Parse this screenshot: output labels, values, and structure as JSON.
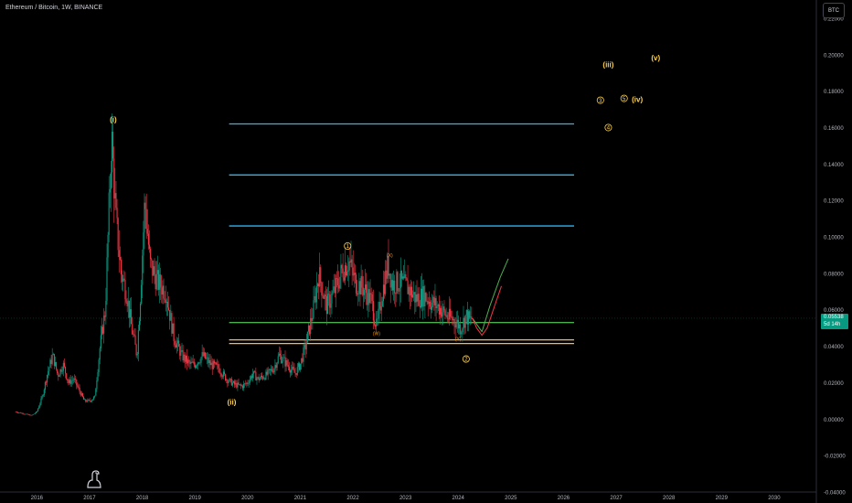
{
  "header": {
    "title": "Ethereum / Bitcoin, 1W, BINANCE",
    "currency_button": "BTC"
  },
  "price_tag": {
    "price": "0.05538",
    "countdown": "5d 14h",
    "color": "#089981"
  },
  "colors": {
    "background": "#000000",
    "candle_up": "#089981",
    "candle_down": "#f23645",
    "fib_lines": "#29b6f6",
    "support_green": "#4caf50",
    "support_orange": "#ffb74d",
    "wave_labels": "#ffd54f",
    "projection": "#4caf50",
    "projection_alt": "#f23645"
  },
  "chart_data": {
    "type": "candlestick",
    "interval": "1W",
    "symbol": "ETHBTC",
    "exchange": "BINANCE",
    "x_axis": {
      "range": [
        2015.3,
        2030.8
      ],
      "tick_labels": [
        "2016",
        "2017",
        "2018",
        "2019",
        "2020",
        "2021",
        "2022",
        "2023",
        "2024",
        "2025",
        "2026",
        "2027",
        "2028",
        "2029",
        "2030"
      ],
      "tick_values": [
        2016,
        2017,
        2018,
        2019,
        2020,
        2021,
        2022,
        2023,
        2024,
        2025,
        2026,
        2027,
        2028,
        2029,
        2030
      ]
    },
    "y_axis": {
      "range": [
        -0.04,
        0.23
      ],
      "position": "right",
      "tick_labels": [
        "0.22000",
        "0.20000",
        "0.18000",
        "0.16000",
        "0.14000",
        "0.12000",
        "0.10000",
        "0.08000",
        "0.06000",
        "0.04000",
        "0.02000",
        "0.00000",
        "-0.02000",
        "-0.04000"
      ],
      "tick_values": [
        0.22,
        0.2,
        0.18,
        0.16,
        0.14,
        0.12,
        0.1,
        0.08,
        0.06,
        0.04,
        0.02,
        0.0,
        -0.02,
        -0.04
      ]
    },
    "price_path": [
      [
        2015.6,
        0.004
      ],
      [
        2015.75,
        0.003
      ],
      [
        2015.9,
        0.002
      ],
      [
        2016.0,
        0.004
      ],
      [
        2016.1,
        0.012
      ],
      [
        2016.2,
        0.025
      ],
      [
        2016.3,
        0.035
      ],
      [
        2016.4,
        0.024
      ],
      [
        2016.5,
        0.03
      ],
      [
        2016.6,
        0.02
      ],
      [
        2016.7,
        0.022
      ],
      [
        2016.8,
        0.016
      ],
      [
        2016.9,
        0.01
      ],
      [
        2017.0,
        0.01
      ],
      [
        2017.1,
        0.012
      ],
      [
        2017.2,
        0.04
      ],
      [
        2017.3,
        0.06
      ],
      [
        2017.42,
        0.155
      ],
      [
        2017.5,
        0.11
      ],
      [
        2017.6,
        0.08
      ],
      [
        2017.7,
        0.07
      ],
      [
        2017.8,
        0.05
      ],
      [
        2017.9,
        0.035
      ],
      [
        2017.97,
        0.07
      ],
      [
        2018.05,
        0.12
      ],
      [
        2018.15,
        0.085
      ],
      [
        2018.3,
        0.075
      ],
      [
        2018.45,
        0.07
      ],
      [
        2018.6,
        0.045
      ],
      [
        2018.75,
        0.035
      ],
      [
        2018.9,
        0.03
      ],
      [
        2019.0,
        0.03
      ],
      [
        2019.15,
        0.035
      ],
      [
        2019.3,
        0.03
      ],
      [
        2019.45,
        0.028
      ],
      [
        2019.6,
        0.022
      ],
      [
        2019.75,
        0.019
      ],
      [
        2019.9,
        0.018
      ],
      [
        2020.0,
        0.02
      ],
      [
        2020.1,
        0.025
      ],
      [
        2020.2,
        0.022
      ],
      [
        2020.35,
        0.024
      ],
      [
        2020.5,
        0.028
      ],
      [
        2020.6,
        0.035
      ],
      [
        2020.75,
        0.03
      ],
      [
        2020.9,
        0.025
      ],
      [
        2021.0,
        0.03
      ],
      [
        2021.1,
        0.04
      ],
      [
        2021.25,
        0.06
      ],
      [
        2021.35,
        0.08
      ],
      [
        2021.5,
        0.062
      ],
      [
        2021.65,
        0.07
      ],
      [
        2021.8,
        0.082
      ],
      [
        2021.92,
        0.087
      ],
      [
        2022.05,
        0.075
      ],
      [
        2022.2,
        0.072
      ],
      [
        2022.35,
        0.065
      ],
      [
        2022.45,
        0.05
      ],
      [
        2022.55,
        0.068
      ],
      [
        2022.67,
        0.085
      ],
      [
        2022.75,
        0.074
      ],
      [
        2022.9,
        0.075
      ],
      [
        2023.05,
        0.072
      ],
      [
        2023.2,
        0.066
      ],
      [
        2023.35,
        0.068
      ],
      [
        2023.5,
        0.064
      ],
      [
        2023.65,
        0.061
      ],
      [
        2023.8,
        0.056
      ],
      [
        2023.95,
        0.054
      ],
      [
        2024.05,
        0.05
      ],
      [
        2024.15,
        0.057
      ],
      [
        2024.22,
        0.054
      ],
      [
        2024.27,
        0.05538
      ]
    ],
    "horizontal_levels": [
      {
        "value": 0.162,
        "color": "#29b6f6",
        "x_range": [
          2019.65,
          2026.2
        ]
      },
      {
        "value": 0.134,
        "color": "#29b6f6",
        "x_range": [
          2019.65,
          2026.2
        ]
      },
      {
        "value": 0.106,
        "color": "#29b6f6",
        "x_range": [
          2019.65,
          2026.2
        ]
      },
      {
        "value": 0.053,
        "color": "#4caf50",
        "x_range": [
          2019.65,
          2026.2
        ]
      },
      {
        "value": 0.0435,
        "color": "#ffb74d",
        "x_range": [
          2019.65,
          2026.2
        ]
      },
      {
        "value": 0.0415,
        "color": "#ffb74d",
        "x_range": [
          2019.65,
          2026.2
        ]
      }
    ],
    "projection_paths": [
      {
        "color": "#4caf50",
        "points": [
          [
            2024.27,
            0.05538
          ],
          [
            2024.45,
            0.048
          ],
          [
            2024.6,
            0.062
          ],
          [
            2024.8,
            0.078
          ],
          [
            2024.95,
            0.088
          ]
        ]
      },
      {
        "color": "#f23645",
        "points": [
          [
            2024.27,
            0.05538
          ],
          [
            2024.35,
            0.05
          ],
          [
            2024.45,
            0.046
          ],
          [
            2024.55,
            0.05
          ],
          [
            2024.7,
            0.063
          ],
          [
            2024.82,
            0.073
          ]
        ]
      }
    ],
    "annotations": [
      {
        "text": "(i)",
        "x": 2017.45,
        "y": 0.163,
        "style": "wave"
      },
      {
        "text": "(ii)",
        "x": 2019.7,
        "y": 0.008,
        "style": "wave"
      },
      {
        "text": "(iii)",
        "x": 2026.85,
        "y": 0.193,
        "style": "wave"
      },
      {
        "text": "(iv)",
        "x": 2027.4,
        "y": 0.174,
        "style": "wave"
      },
      {
        "text": "(v)",
        "x": 2027.75,
        "y": 0.197,
        "style": "wave"
      },
      {
        "text": "1",
        "x": 2021.9,
        "y": 0.095,
        "style": "circled"
      },
      {
        "text": "2",
        "x": 2024.15,
        "y": 0.033,
        "style": "circled"
      },
      {
        "text": "3",
        "x": 2026.7,
        "y": 0.175,
        "style": "circled"
      },
      {
        "text": "4",
        "x": 2026.85,
        "y": 0.16,
        "style": "circled"
      },
      {
        "text": "5",
        "x": 2027.15,
        "y": 0.176,
        "style": "circled"
      },
      {
        "text": "(X)",
        "x": 2022.7,
        "y": 0.089,
        "style": "small"
      },
      {
        "text": "(W)",
        "x": 2022.45,
        "y": 0.046,
        "style": "small"
      },
      {
        "text": "(Y)",
        "x": 2024.0,
        "y": 0.043,
        "style": "small"
      }
    ]
  }
}
